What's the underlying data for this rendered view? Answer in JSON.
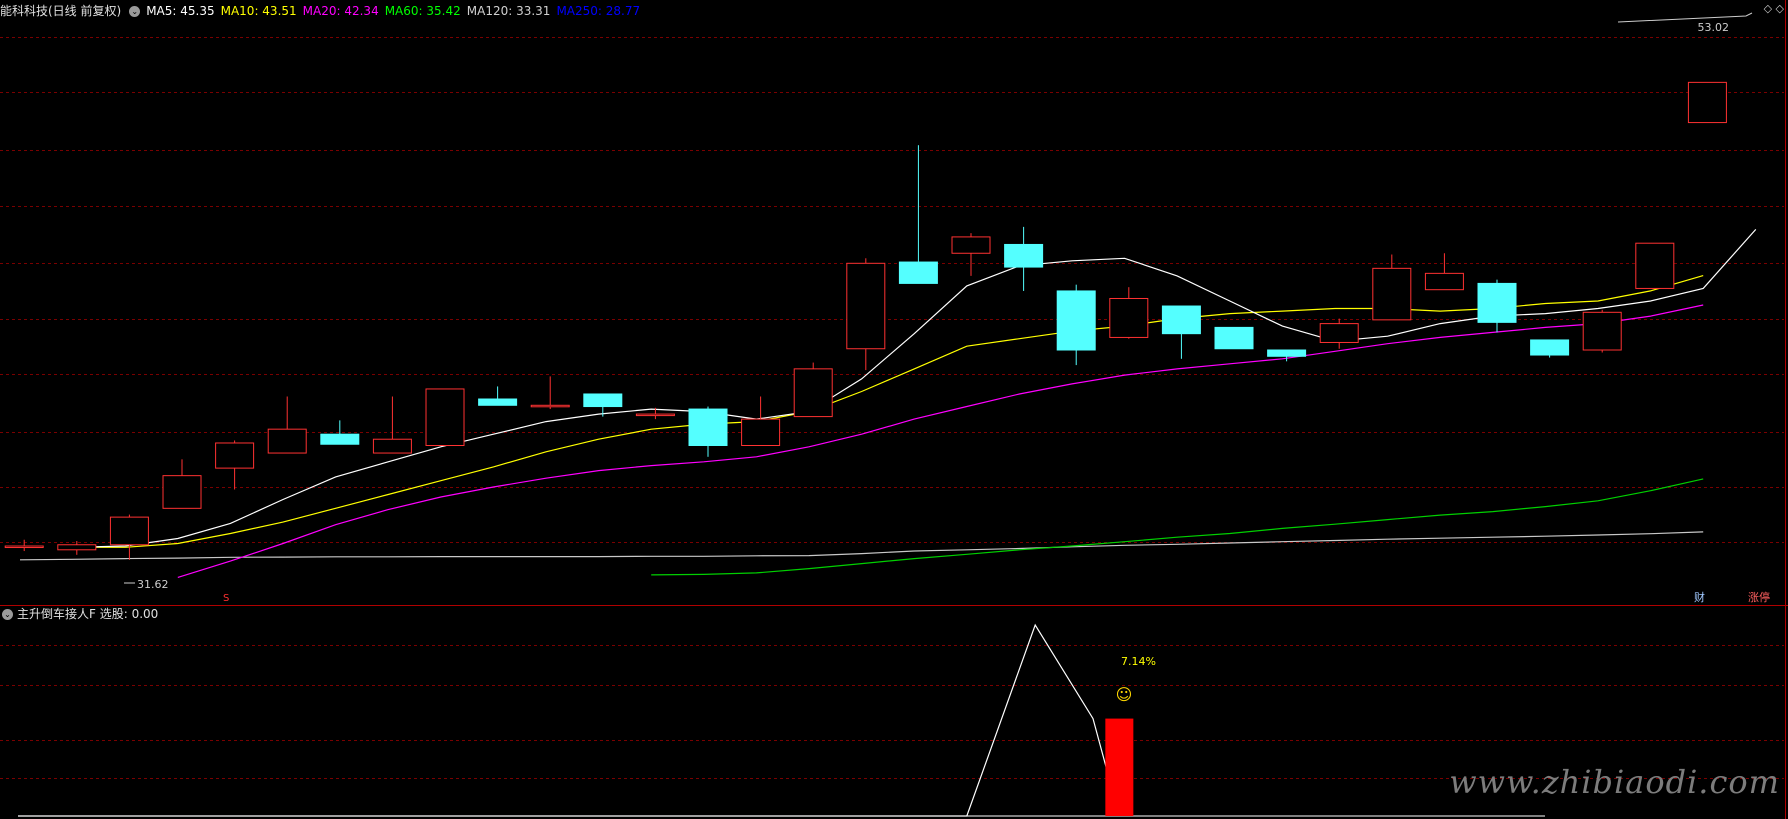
{
  "main_header": {
    "stock": "能科科技(日线 前复权)",
    "ma_items": [
      {
        "label": "MA5: 45.35",
        "color": "#ffffff"
      },
      {
        "label": "MA10: 43.51",
        "color": "#ffff00"
      },
      {
        "label": "MA20: 42.34",
        "color": "#ff00ff"
      },
      {
        "label": "MA60: 35.42",
        "color": "#00ff00"
      },
      {
        "label": "MA120: 33.31",
        "color": "#d0d0d0"
      },
      {
        "label": "MA250: 28.77",
        "color": "#0000ff"
      }
    ]
  },
  "price_labels": {
    "high": "53.02",
    "low": "31.62",
    "signal_s": "S",
    "cai": "财",
    "zhangting": "涨停"
  },
  "indicator": {
    "header": "主升倒车接人F",
    "select_label": "选股: 0.00",
    "percent": "7.14%",
    "smiley": "☺"
  },
  "watermark": "www.zhibiaodi.com",
  "corner_icons": "◇ ◇",
  "colors": {
    "background": "#000000",
    "grid": "#7a0000",
    "up": "#ff3232",
    "down": "#54ffff",
    "ma5": "#ffffff",
    "ma10": "#ffff00",
    "ma20": "#ff00ff",
    "ma60": "#00d000",
    "ma120": "#c8c8c8",
    "signal_bar": "#ff0000",
    "signal_line": "#ffffff",
    "percent_text": "#ffff00"
  },
  "chart_data": {
    "type": "candlestick",
    "y_range": [
      31.0,
      54.0
    ],
    "grid_levels": [
      53.0,
      50.8,
      48.5,
      46.3,
      44.0,
      41.8,
      39.6,
      37.3,
      35.1,
      32.9
    ],
    "candles": [
      {
        "o": 32.75,
        "h": 33.0,
        "l": 32.55,
        "c": 32.75
      },
      {
        "o": 32.6,
        "h": 32.95,
        "l": 32.4,
        "c": 32.8
      },
      {
        "o": 32.8,
        "h": 34.0,
        "l": 32.2,
        "c": 33.9
      },
      {
        "o": 34.25,
        "h": 36.2,
        "l": 34.25,
        "c": 35.55
      },
      {
        "o": 35.85,
        "h": 36.95,
        "l": 35.0,
        "c": 36.85
      },
      {
        "o": 36.45,
        "h": 38.7,
        "l": 36.45,
        "c": 37.4
      },
      {
        "o": 37.2,
        "h": 37.75,
        "l": 36.95,
        "c": 36.8
      },
      {
        "o": 36.45,
        "h": 38.7,
        "l": 36.45,
        "c": 37.0
      },
      {
        "o": 36.75,
        "h": 38.9,
        "l": 36.75,
        "c": 39.0
      },
      {
        "o": 38.6,
        "h": 39.1,
        "l": 38.35,
        "c": 38.35
      },
      {
        "o": 38.35,
        "h": 39.5,
        "l": 38.2,
        "c": 38.35
      },
      {
        "o": 38.8,
        "h": 38.8,
        "l": 37.9,
        "c": 38.3
      },
      {
        "o": 38.0,
        "h": 38.25,
        "l": 37.8,
        "c": 38.0
      },
      {
        "o": 38.2,
        "h": 38.3,
        "l": 36.3,
        "c": 36.75
      },
      {
        "o": 36.75,
        "h": 38.7,
        "l": 36.75,
        "c": 37.8
      },
      {
        "o": 37.9,
        "h": 40.05,
        "l": 37.9,
        "c": 39.8
      },
      {
        "o": 40.6,
        "h": 44.2,
        "l": 39.75,
        "c": 44.0
      },
      {
        "o": 44.05,
        "h": 48.7,
        "l": 43.35,
        "c": 43.2
      },
      {
        "o": 44.4,
        "h": 45.2,
        "l": 43.5,
        "c": 45.05
      },
      {
        "o": 44.75,
        "h": 45.45,
        "l": 42.9,
        "c": 43.85
      },
      {
        "o": 42.9,
        "h": 43.15,
        "l": 39.95,
        "c": 40.55
      },
      {
        "o": 41.05,
        "h": 43.05,
        "l": 41.0,
        "c": 42.6
      },
      {
        "o": 42.3,
        "h": 42.3,
        "l": 40.2,
        "c": 41.2
      },
      {
        "o": 41.45,
        "h": 41.45,
        "l": 40.6,
        "c": 40.6
      },
      {
        "o": 40.55,
        "h": 40.55,
        "l": 40.1,
        "c": 40.3
      },
      {
        "o": 40.85,
        "h": 41.8,
        "l": 40.6,
        "c": 41.6
      },
      {
        "o": 41.75,
        "h": 44.35,
        "l": 41.75,
        "c": 43.8
      },
      {
        "o": 42.95,
        "h": 44.4,
        "l": 42.95,
        "c": 43.6
      },
      {
        "o": 43.2,
        "h": 43.35,
        "l": 41.25,
        "c": 41.65
      },
      {
        "o": 40.95,
        "h": 40.95,
        "l": 40.25,
        "c": 40.35
      },
      {
        "o": 40.55,
        "h": 42.15,
        "l": 40.45,
        "c": 42.05
      },
      {
        "o": 43.0,
        "h": 44.8,
        "l": 43.0,
        "c": 44.8
      },
      {
        "o": 49.6,
        "h": 51.2,
        "l": 49.6,
        "c": 51.2
      }
    ],
    "ma5": [
      null,
      32.7,
      32.75,
      33.05,
      33.65,
      34.6,
      35.5,
      36.1,
      36.7,
      37.2,
      37.7,
      38.0,
      38.2,
      38.1,
      37.8,
      38.1,
      39.4,
      41.2,
      43.1,
      43.9,
      44.1,
      44.2,
      43.5,
      42.5,
      41.5,
      40.9,
      41.1,
      41.6,
      41.9,
      42.0,
      42.2,
      42.5,
      43.0,
      45.35
    ],
    "ma10": [
      null,
      32.7,
      32.7,
      32.85,
      33.25,
      33.7,
      34.25,
      34.8,
      35.35,
      35.9,
      36.5,
      37.0,
      37.4,
      37.6,
      37.7,
      38.1,
      38.9,
      39.8,
      40.7,
      41.0,
      41.3,
      41.5,
      41.8,
      42.0,
      42.1,
      42.2,
      42.2,
      42.1,
      42.2,
      42.4,
      42.5,
      42.9,
      43.51
    ],
    "ma20": [
      null,
      null,
      null,
      31.5,
      32.15,
      32.85,
      33.6,
      34.2,
      34.7,
      35.1,
      35.45,
      35.75,
      35.95,
      36.1,
      36.3,
      36.7,
      37.2,
      37.8,
      38.3,
      38.8,
      39.2,
      39.55,
      39.8,
      40.0,
      40.2,
      40.5,
      40.8,
      41.05,
      41.25,
      41.45,
      41.6,
      41.9,
      42.34
    ],
    "ma60": [
      null,
      null,
      null,
      null,
      null,
      null,
      null,
      null,
      null,
      null,
      null,
      null,
      31.6,
      31.62,
      31.68,
      31.85,
      32.05,
      32.25,
      32.42,
      32.6,
      32.75,
      32.92,
      33.1,
      33.25,
      33.45,
      33.62,
      33.8,
      33.98,
      34.12,
      34.32,
      34.55,
      34.95,
      35.42
    ],
    "ma120": [
      32.2,
      32.22,
      32.25,
      32.27,
      32.3,
      32.31,
      32.32,
      32.32,
      32.33,
      32.33,
      32.33,
      32.33,
      32.34,
      32.34,
      32.36,
      32.37,
      32.45,
      32.55,
      32.6,
      32.65,
      32.72,
      32.78,
      32.82,
      32.87,
      32.92,
      32.97,
      33.02,
      33.06,
      33.1,
      33.14,
      33.19,
      33.24,
      33.31
    ],
    "indicator": {
      "signal_line_x_index": [
        0,
        18,
        19.3,
        20.4,
        20.9
      ],
      "signal_line_y": [
        0,
        0,
        1,
        0.51,
        0
      ],
      "red_bar_index": 20.9,
      "red_bar_value": 0.51
    }
  }
}
